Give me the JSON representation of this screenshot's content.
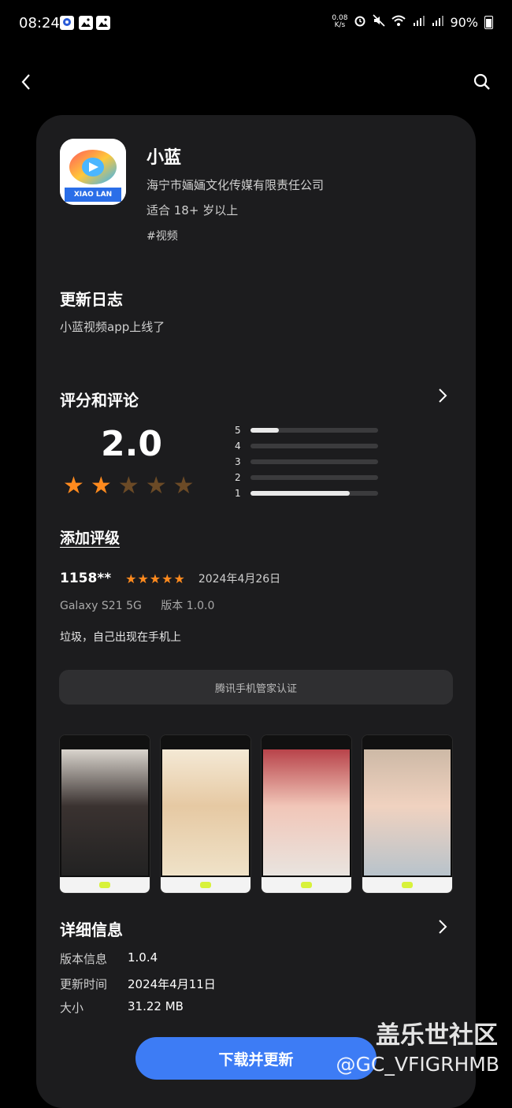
{
  "status_bar": {
    "time": "08:24",
    "net_speed_top": "0.08",
    "net_speed_bottom": "K/s",
    "battery": "90%"
  },
  "app": {
    "name": "小蓝",
    "developer": "海宁市婳婳文化传媒有限责任公司",
    "age_rating": "适合 18+ 岁以上",
    "tag": "#视频",
    "icon_text": "XIAO LAN"
  },
  "changelog": {
    "title": "更新日志",
    "text": "小蓝视频app上线了"
  },
  "ratings": {
    "title": "评分和评论",
    "score": "2.0",
    "stars_filled": 2,
    "stars_total": 5,
    "distribution": [
      {
        "label": "5",
        "fraction": 0.22
      },
      {
        "label": "4",
        "fraction": 0.0
      },
      {
        "label": "3",
        "fraction": 0.0
      },
      {
        "label": "2",
        "fraction": 0.0
      },
      {
        "label": "1",
        "fraction": 0.78
      }
    ],
    "add_rating": "添加评级"
  },
  "review": {
    "user": "1158**",
    "stars": "★★★★★",
    "date": "2024年4月26日",
    "device": "Galaxy S21 5G",
    "version": "版本 1.0.0",
    "body": "垃圾，自己出现在手机上"
  },
  "verification": "腾讯手机管家认证",
  "details": {
    "title": "详细信息",
    "rows": [
      {
        "key": "版本信息",
        "value": "1.0.4"
      },
      {
        "key": "更新时间",
        "value": "2024年4月11日"
      },
      {
        "key": "大小",
        "value": "31.22 MB"
      }
    ]
  },
  "download_button": "下载并更新",
  "watermark": {
    "site": "盖乐世社区",
    "user": "@GC_VFIGRHMB"
  },
  "colors": {
    "background": "#000000",
    "card": "#1c1c1e",
    "star": "#ff8a1e",
    "button": "#3d7cf5"
  }
}
